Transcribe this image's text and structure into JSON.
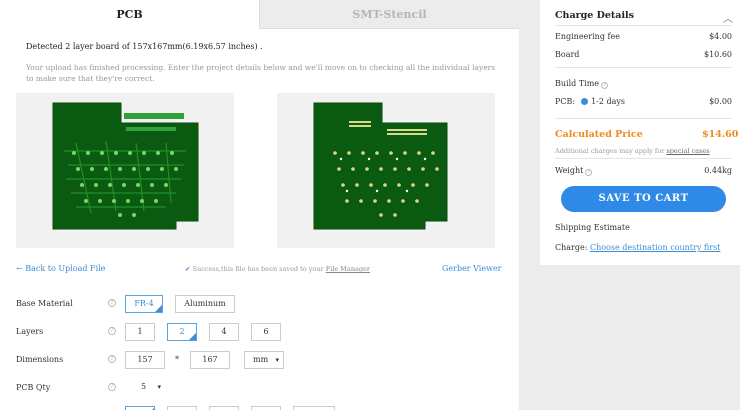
{
  "tabs": {
    "pcb": "PCB",
    "stencil": "SMT-Stencil"
  },
  "upload": {
    "detected": "Detected 2 layer board of 157x167mm(6.19x6.57 inches) .",
    "note": "Your upload has finished processing. Enter the project details below and we'll move on to checking all the individual layers to make sure that they're correct.",
    "back_link": "Back to Upload File",
    "saved_prefix": "Success,this file has been saved to your",
    "saved_link": "File Manager",
    "gerber_viewer": "Gerber Viewer"
  },
  "form": {
    "base_material": {
      "label": "Base Material",
      "options": [
        "FR-4",
        "Aluminum"
      ],
      "selected": "FR-4"
    },
    "layers": {
      "label": "Layers",
      "options": [
        "1",
        "2",
        "4",
        "6"
      ],
      "selected": "2"
    },
    "dimensions": {
      "label": "Dimensions",
      "width": "157",
      "times": "*",
      "height": "167",
      "unit": "mm"
    },
    "pcb_qty": {
      "label": "PCB Qty",
      "value": "5"
    }
  },
  "charge": {
    "title": "Charge Details",
    "engineering_fee": {
      "label": "Engineering fee",
      "value": "$4.00"
    },
    "board": {
      "label": "Board",
      "value": "$10.60"
    },
    "build_time": {
      "label": "Build Time"
    },
    "pcb_build": {
      "label": "PCB:",
      "option": "1-2 days",
      "value": "$0.00"
    },
    "calculated": {
      "label": "Calculated Price",
      "value": "$14.60"
    },
    "additional_prefix": "Additional charges may apply for",
    "additional_link": "special cases",
    "weight": {
      "label": "Weight",
      "value": "0.44kg"
    },
    "cart_button": "SAVE TO CART",
    "shipping": "Shipping Estimate",
    "charge_label": "Charge:",
    "charge_link": "Choose destination country first"
  },
  "colors": {
    "accent": "#2e8ae6",
    "price": "#f08a1c",
    "pcb_green": "#0b5a12"
  }
}
